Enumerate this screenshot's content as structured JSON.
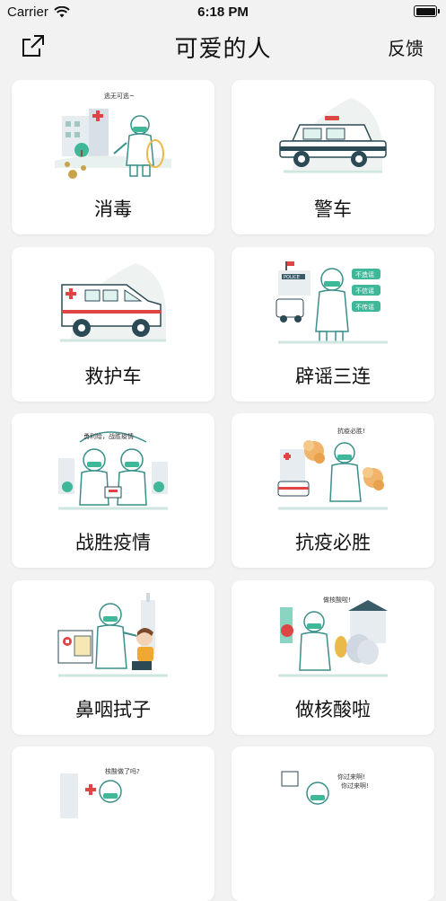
{
  "status_bar": {
    "carrier": "Carrier",
    "time": "6:18 PM"
  },
  "nav": {
    "title": "可爱的人",
    "feedback": "反馈"
  },
  "cards": [
    {
      "label": "消毒",
      "caption": "逃无可逃~"
    },
    {
      "label": "警车"
    },
    {
      "label": "救护车"
    },
    {
      "label": "辟谣三连",
      "signs": [
        "不造谣",
        "不信谣",
        "不传谣"
      ],
      "caption": "POLICE"
    },
    {
      "label": "战胜疫情",
      "caption": "勇利给，战胜疫情"
    },
    {
      "label": "抗疫必胜",
      "caption": "抗疫必胜!"
    },
    {
      "label": "鼻咽拭子"
    },
    {
      "label": "做核酸啦",
      "caption": "做核酸啦!"
    },
    {
      "label": "",
      "caption": "核酸做了吗?"
    },
    {
      "label": "",
      "caption": "你过来啊!"
    }
  ],
  "colors": {
    "accent_green": "#3fb89a",
    "accent_red": "#e04545",
    "label_text": "#111111"
  }
}
